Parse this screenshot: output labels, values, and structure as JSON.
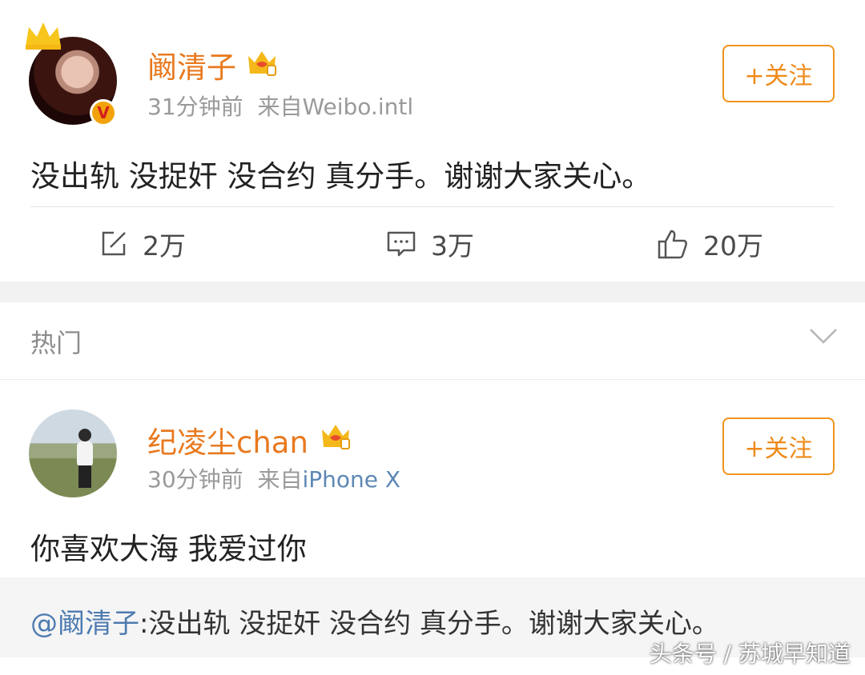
{
  "post1": {
    "username": "阚清子",
    "time": "31分钟前",
    "source_prefix": "来自",
    "source": "Weibo.intl",
    "follow_label": "+关注",
    "text": "没出轨 没捉奸 没合约 真分手。谢谢大家关心。",
    "verified_badge": "V",
    "actions": {
      "repost_count": "2万",
      "comment_count": "3万",
      "like_count": "20万"
    }
  },
  "hot_section": {
    "title": "热门"
  },
  "post2": {
    "username": "纪凌尘chan",
    "time": "30分钟前",
    "source_prefix": "来自",
    "source": "iPhone X",
    "follow_label": "+关注",
    "text": "你喜欢大海 我爱过你",
    "quote_mention": "@阚清子",
    "quote_text": ":没出轨 没捉奸 没合约 真分手。谢谢大家关心。"
  },
  "watermark": "头条号 / 苏城早知道",
  "colors": {
    "username": "#e8791e",
    "follow_border": "#f0931f",
    "link": "#5e88b4",
    "meta": "#9a9a9a",
    "section_bg": "#f2f2f2"
  },
  "icons": [
    "crown-icon",
    "vip-crown-icon",
    "verified-v-icon",
    "repost-icon",
    "comment-icon",
    "like-icon",
    "chevron-down-icon"
  ]
}
